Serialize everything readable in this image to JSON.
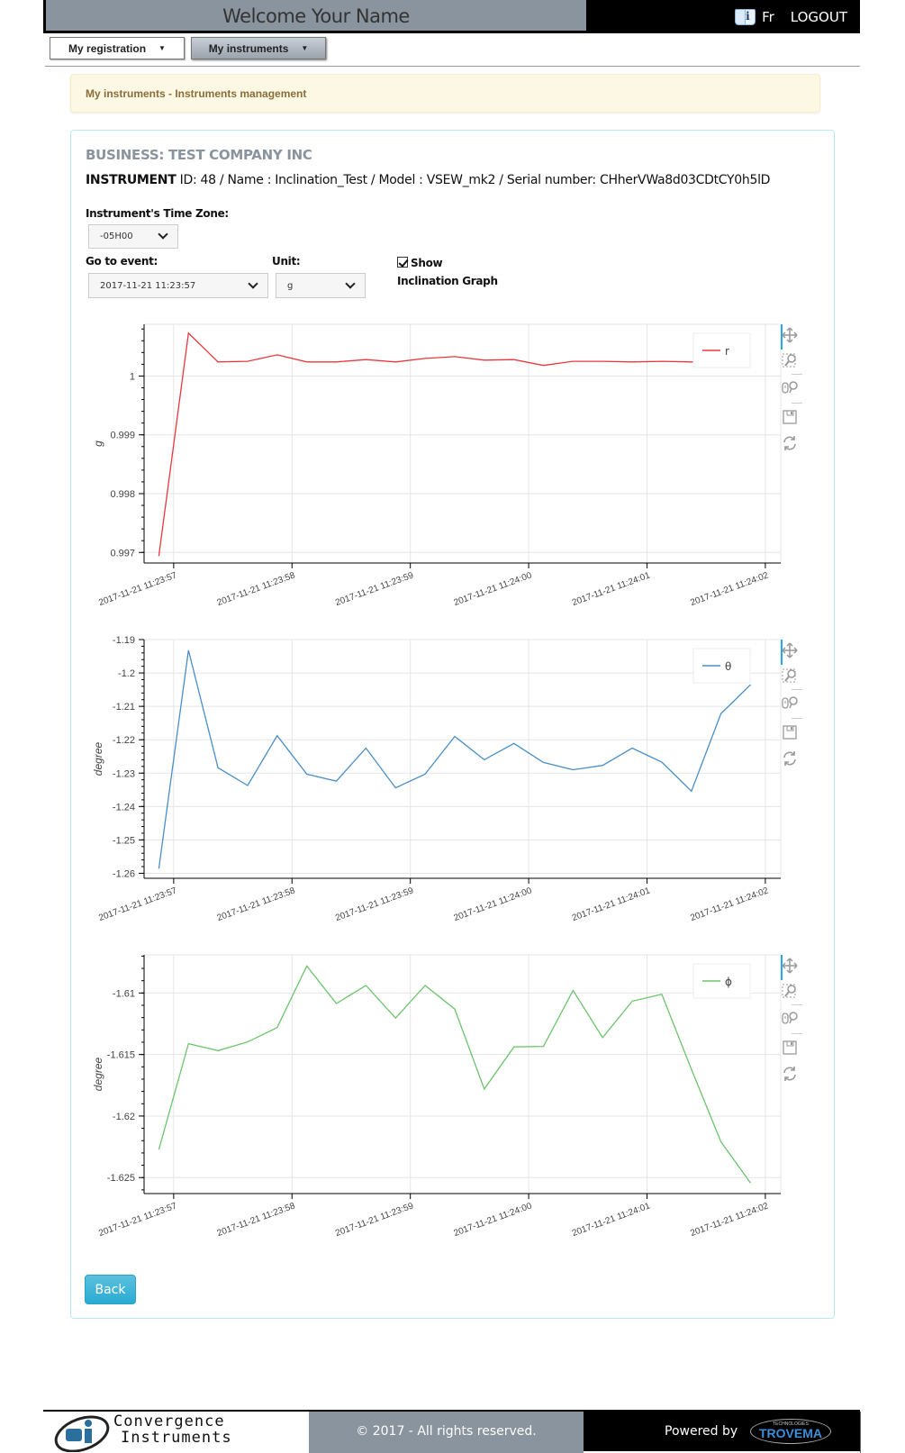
{
  "header": {
    "welcome": "Welcome  Your Name",
    "help_icon": "help-book-icon",
    "language": "Fr",
    "logout": "LOGOUT"
  },
  "nav": [
    {
      "label": "My registration",
      "icon": "caret-down-icon"
    },
    {
      "label": "My instruments",
      "icon": "caret-down-icon"
    }
  ],
  "alert": "My instruments - Instruments management",
  "business": "BUSINESS: TEST COMPANY INC",
  "instrument": {
    "label": "INSTRUMENT",
    "details": " ID: 48 / Name : Inclination_Test / Model : VSEW_mk2 / Serial number: CHherVWa8d03CDtCY0h5lD"
  },
  "form": {
    "timezone_label": "Instrument's Time Zone:",
    "timezone_value": "-05H00",
    "event_label": "Go to event:",
    "event_value": "2017-11-21 11:23:57",
    "unit_label": "Unit:",
    "unit_value": "g",
    "show_label": "Show",
    "show_sub_label": "Inclination Graph",
    "show_checked": true
  },
  "toolbar_icons": [
    "pan-icon",
    "box-zoom-icon",
    "wheel-zoom-icon",
    "save-icon",
    "reset-icon"
  ],
  "back_label": "Back",
  "footer": {
    "brand_line1": "Convergence",
    "brand_line2": "Instruments",
    "copyright": "© 2017 - All rights reserved.",
    "powered_by": "Powered by",
    "partner": "TROVEMA",
    "partner_sub": "TECHNOLOGIES"
  },
  "chart_data": [
    {
      "type": "line",
      "title": "",
      "xlabel": "",
      "ylabel": "g",
      "legend": "r",
      "legend_position": "top-right",
      "color": "#e8383d",
      "x_ticks": [
        "2017-11-21 11:23:57",
        "2017-11-21 11:23:58",
        "2017-11-21 11:23:59",
        "2017-11-21 11:24:00",
        "2017-11-21 11:24:01",
        "2017-11-21 11:24:02"
      ],
      "x_seconds_start": 56.875,
      "x_step_seconds": 0.25,
      "xlim_seconds": [
        56.75,
        62.13
      ],
      "y_ticks": [
        0.997,
        0.998,
        0.999,
        1
      ],
      "ylim": [
        0.99682,
        1.00088
      ],
      "grid": true,
      "values": [
        0.99694,
        1.00073,
        1.00024,
        1.00025,
        1.00036,
        1.00024,
        1.00024,
        1.00028,
        1.00024,
        1.0003,
        1.00033,
        1.00027,
        1.00028,
        1.00018,
        1.00025,
        1.00025,
        1.00024,
        1.00025,
        1.00024,
        1.00026,
        1.00031
      ]
    },
    {
      "type": "line",
      "title": "",
      "xlabel": "",
      "ylabel": "degree",
      "legend": "θ",
      "legend_position": "top-right",
      "color": "#4a8ec8",
      "x_ticks": [
        "2017-11-21 11:23:57",
        "2017-11-21 11:23:58",
        "2017-11-21 11:23:59",
        "2017-11-21 11:24:00",
        "2017-11-21 11:24:01",
        "2017-11-21 11:24:02"
      ],
      "x_seconds_start": 56.875,
      "x_step_seconds": 0.25,
      "xlim_seconds": [
        56.75,
        62.13
      ],
      "y_ticks": [
        -1.26,
        -1.25,
        -1.24,
        -1.23,
        -1.22,
        -1.21,
        -1.2,
        -1.19
      ],
      "ylim": [
        -1.2615,
        -1.19
      ],
      "grid": true,
      "values": [
        -1.2586,
        -1.1932,
        -1.2284,
        -1.2337,
        -1.2188,
        -1.2303,
        -1.2324,
        -1.2225,
        -1.2344,
        -1.2303,
        -1.219,
        -1.226,
        -1.2211,
        -1.2268,
        -1.229,
        -1.2277,
        -1.2225,
        -1.2267,
        -1.2354,
        -1.2122,
        -1.2035
      ]
    },
    {
      "type": "line",
      "title": "",
      "xlabel": "",
      "ylabel": "degree",
      "legend": "ϕ",
      "legend_position": "top-right",
      "color": "#6cc46c",
      "x_ticks": [
        "2017-11-21 11:23:57",
        "2017-11-21 11:23:58",
        "2017-11-21 11:23:59",
        "2017-11-21 11:24:00",
        "2017-11-21 11:24:01",
        "2017-11-21 11:24:02"
      ],
      "x_seconds_start": 56.875,
      "x_step_seconds": 0.25,
      "xlim_seconds": [
        56.75,
        62.13
      ],
      "y_ticks": [
        -1.625,
        -1.62,
        -1.615,
        -1.61
      ],
      "ylim": [
        -1.6263,
        -1.6069
      ],
      "grid": true,
      "values": [
        -1.62272,
        -1.61412,
        -1.61468,
        -1.61398,
        -1.61281,
        -1.60781,
        -1.61085,
        -1.60939,
        -1.61204,
        -1.60939,
        -1.61131,
        -1.61781,
        -1.61438,
        -1.61434,
        -1.60979,
        -1.61363,
        -1.61066,
        -1.6101,
        -1.6162,
        -1.62209,
        -1.62544
      ]
    }
  ]
}
